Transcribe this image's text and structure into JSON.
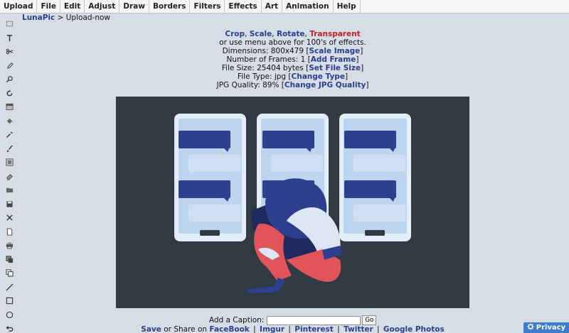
{
  "menu": [
    "Upload",
    "File",
    "Edit",
    "Adjust",
    "Draw",
    "Borders",
    "Filters",
    "Effects",
    "Art",
    "Animation",
    "Help"
  ],
  "breadcrumb": {
    "site": "LunaPic",
    "sep": " > ",
    "page": "Upload-now"
  },
  "info": {
    "crop": "Crop",
    "scale": "Scale",
    "rotate": "Rotate",
    "transparent": "Transparent",
    "comma": ", ",
    "effects_line": "or use menu above for 100's of effects.",
    "dimensions_label": "Dimensions: 800x479 [",
    "dimensions_link": "Scale Image",
    "frames_label": "Number of Frames: 1 [",
    "frames_link": "Add Frame",
    "filesize_label": "File Size: 25404 bytes [",
    "filesize_link": "Set File Size",
    "filetype_label": "File Type: jpg [",
    "filetype_link": "Change Type",
    "quality_label": "JPG Quality: 89% [",
    "quality_link": "Change JPG Quality",
    "close_bracket": "]"
  },
  "caption": {
    "label": "Add a Caption:",
    "value": "",
    "go": "Go"
  },
  "share": {
    "save": "Save",
    "or_share_on": " or Share on ",
    "facebook": "FaceBook",
    "imgur": "Imgur",
    "pinterest": "Pinterest",
    "twitter": "Twitter",
    "google_photos": "Google Photos",
    "separator": "|"
  },
  "privacy": {
    "label": "Privacy",
    "icon": "gear-icon"
  },
  "toolbar_icons": [
    "marquee-select-icon",
    "text-icon",
    "scissors-icon",
    "pencil-icon",
    "zoom-icon",
    "rotate-icon",
    "gradient-icon",
    "paint-bucket-icon",
    "eyedropper-icon",
    "brush-icon",
    "resize-icon",
    "eraser-icon",
    "open-folder-icon",
    "save-disk-icon",
    "close-x-icon",
    "new-page-icon",
    "print-icon",
    "layers-icon",
    "copy-icon",
    "line-icon",
    "rectangle-icon",
    "circle-icon",
    "undo-icon",
    "help-icon"
  ],
  "colors": {
    "accent_link": "#2a3f8f",
    "transparent_link": "#c11e1e",
    "privacy_bg": "#3f7cc9"
  }
}
